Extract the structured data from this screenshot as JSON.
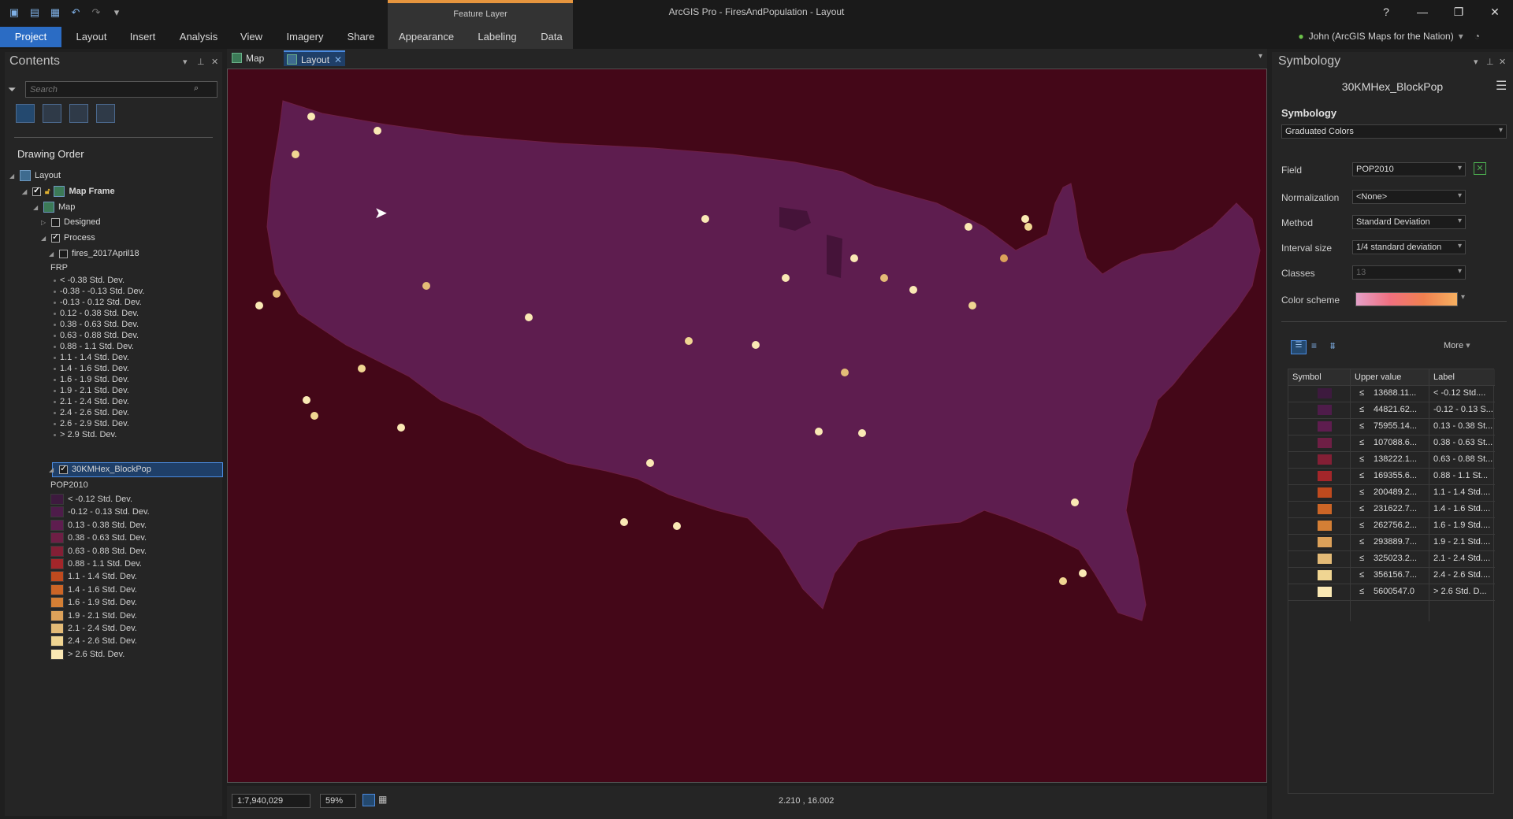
{
  "titlebar": {
    "app_title": "ArcGIS Pro - FiresAndPopulation - Layout",
    "contextual_header": "Feature Layer",
    "help": "?",
    "minimize": "—",
    "restore": "❐",
    "close": "✕"
  },
  "ribbon": {
    "tabs": [
      "Project",
      "Layout",
      "Insert",
      "Analysis",
      "View",
      "Imagery",
      "Share"
    ],
    "contextual_tabs": [
      "Appearance",
      "Labeling",
      "Data"
    ],
    "user": "John (ArcGIS Maps for the Nation)"
  },
  "contents": {
    "title": "Contents",
    "search_placeholder": "Search",
    "drawing_order": "Drawing Order",
    "tree": {
      "layout": "Layout",
      "map_frame": "Map Frame",
      "map": "Map",
      "designed": "Designed",
      "process": "Process",
      "fires_layer": "fires_2017April18",
      "fires_field": "FRP",
      "fires_classes": [
        "< -0.38 Std. Dev.",
        "-0.38 - -0.13 Std. Dev.",
        "-0.13 - 0.12 Std. Dev.",
        "0.12 - 0.38 Std. Dev.",
        "0.38 - 0.63 Std. Dev.",
        "0.63 - 0.88 Std. Dev.",
        "0.88 - 1.1 Std. Dev.",
        "1.1 - 1.4 Std. Dev.",
        "1.4 - 1.6 Std. Dev.",
        "1.6 - 1.9 Std. Dev.",
        "1.9 - 2.1 Std. Dev.",
        "2.1 - 2.4 Std. Dev.",
        "2.4 - 2.6 Std. Dev.",
        "2.6 - 2.9 Std. Dev.",
        "> 2.9 Std. Dev."
      ],
      "hex_layer": "30KMHex_BlockPop",
      "hex_field": "POP2010",
      "hex_classes": [
        "< -0.12 Std. Dev.",
        "-0.12 - 0.13 Std. Dev.",
        "0.13 - 0.38 Std. Dev.",
        "0.38 - 0.63 Std. Dev.",
        "0.63 - 0.88 Std. Dev.",
        "0.88 - 1.1 Std. Dev.",
        "1.1 - 1.4 Std. Dev.",
        "1.4 - 1.6 Std. Dev.",
        "1.6 - 1.9 Std. Dev.",
        "1.9 - 2.1 Std. Dev.",
        "2.1 - 2.4 Std. Dev.",
        "2.4 - 2.6 Std. Dev.",
        "> 2.6 Std. Dev."
      ]
    }
  },
  "doc_tabs": {
    "map": "Map",
    "layout": "Layout"
  },
  "statusbar": {
    "scale": "1:7,940,029",
    "zoom": "59%",
    "coords": "2.210 , 16.002"
  },
  "symbology": {
    "title": "Symbology",
    "layer_name": "30KMHex_BlockPop",
    "section": "Symbology",
    "renderer": "Graduated Colors",
    "field_label": "Field",
    "field_value": "POP2010",
    "normalization_label": "Normalization",
    "normalization_value": "<None>",
    "method_label": "Method",
    "method_value": "Standard Deviation",
    "interval_label": "Interval size",
    "interval_value": "1/4 standard deviation",
    "classes_label": "Classes",
    "classes_value": "13",
    "color_scheme_label": "Color scheme",
    "more": "More",
    "table_headers": [
      "Symbol",
      "Upper value",
      "Label"
    ],
    "rows": [
      {
        "upper": "13688.11...",
        "label": "< -0.12 Std...."
      },
      {
        "upper": "44821.62...",
        "label": "-0.12 - 0.13 S..."
      },
      {
        "upper": "75955.14...",
        "label": "0.13 - 0.38 St..."
      },
      {
        "upper": "107088.6...",
        "label": "0.38 - 0.63 St..."
      },
      {
        "upper": "138222.1...",
        "label": "0.63 - 0.88 St..."
      },
      {
        "upper": "169355.6...",
        "label": "0.88 - 1.1 St..."
      },
      {
        "upper": "200489.2...",
        "label": "1.1 - 1.4 Std...."
      },
      {
        "upper": "231622.7...",
        "label": "1.4 - 1.6 Std...."
      },
      {
        "upper": "262756.2...",
        "label": "1.6 - 1.9 Std...."
      },
      {
        "upper": "293889.7...",
        "label": "1.9 - 2.1 Std...."
      },
      {
        "upper": "325023.2...",
        "label": "2.1 - 2.4 Std...."
      },
      {
        "upper": "356156.7...",
        "label": "2.4 - 2.6 Std...."
      },
      {
        "upper": "5600547.0",
        "label": "> 2.6 Std. D..."
      }
    ],
    "le": "≤"
  },
  "colors": {
    "hex_ramp": [
      "#3d1a3e",
      "#4e1c4a",
      "#5e1d4f",
      "#6e1f45",
      "#831f35",
      "#a3262a",
      "#bf4a1e",
      "#cc6526",
      "#d47f35",
      "#dca15a",
      "#e4bb77",
      "#f0d592",
      "#fae8b4"
    ],
    "map_background": "#440718",
    "accent": "#2b6cc4"
  }
}
